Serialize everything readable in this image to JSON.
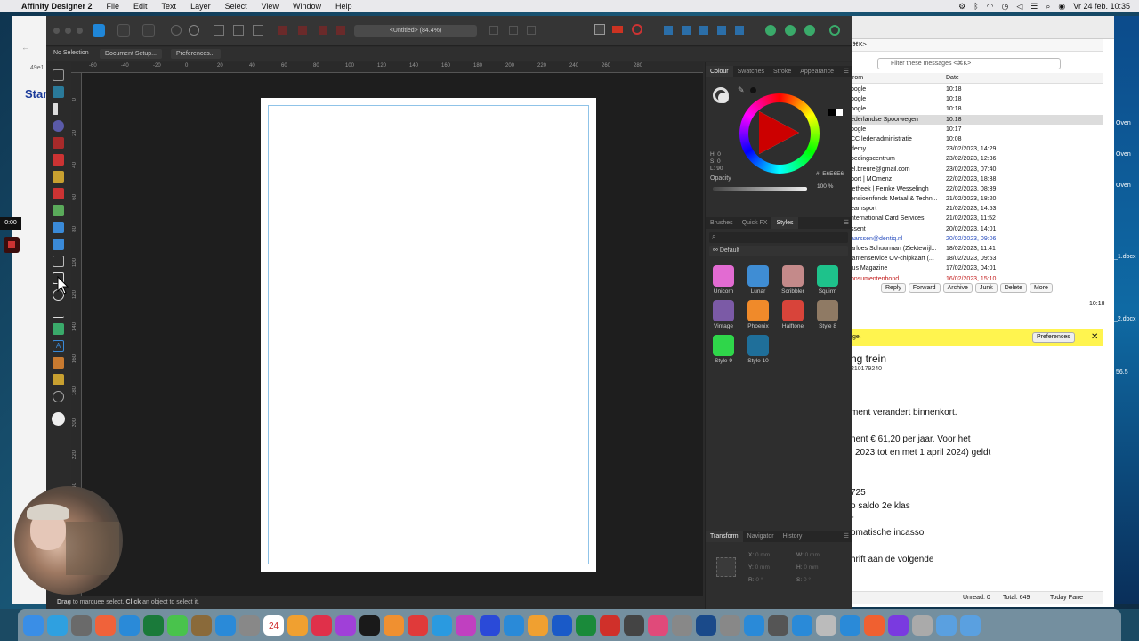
{
  "menubar": {
    "apple": "",
    "app_name": "Affinity Designer 2",
    "items": [
      "File",
      "Edit",
      "Text",
      "Layer",
      "Select",
      "View",
      "Window",
      "Help"
    ],
    "clock": "Vr 24 feb.  10:35"
  },
  "affinity": {
    "document_title": "<Untitled> (84.4%)",
    "context": {
      "selection": "No Selection",
      "document_setup": "Document Setup...",
      "preferences": "Preferences..."
    },
    "ruler_h": [
      "-60",
      "-40",
      "-20",
      "0",
      "20",
      "40",
      "60",
      "80",
      "100",
      "120",
      "140",
      "160",
      "180",
      "200",
      "220",
      "240",
      "260",
      "280"
    ],
    "ruler_v": [
      "0",
      "20",
      "40",
      "60",
      "80",
      "100",
      "120",
      "140",
      "160",
      "180",
      "200",
      "220",
      "240",
      "260",
      "280"
    ],
    "status_bold1": "Drag",
    "status_text1": " to marquee select. ",
    "status_bold2": "Click",
    "status_text2": " an object to select it.",
    "colour_panel": {
      "tabs": [
        "Colour",
        "Swatches",
        "Stroke",
        "Appearance"
      ],
      "hsl": [
        "H: 0",
        "S: 0",
        "L: 90"
      ],
      "hex": "#: E6E6E6",
      "opacity_label": "Opacity",
      "opacity_value": "100 %"
    },
    "styles_panel": {
      "tabs": [
        "Brushes",
        "Quick FX",
        "Styles"
      ],
      "category": "Default",
      "styles": [
        {
          "name": "Unicorn",
          "color": "#e26bd2"
        },
        {
          "name": "Lunar",
          "color": "#3f8dd4"
        },
        {
          "name": "Scribbler",
          "color": "#c48a8a"
        },
        {
          "name": "Squirm",
          "color": "#1ec28b"
        },
        {
          "name": "Vintage",
          "color": "#7b5aa6"
        },
        {
          "name": "Phoenix",
          "color": "#f08a2a"
        },
        {
          "name": "Halftone",
          "color": "#d8443a"
        },
        {
          "name": "Style 8",
          "color": "#8f7a64"
        },
        {
          "name": "Style 9",
          "color": "#2fd64a"
        },
        {
          "name": "Style 10",
          "color": "#1f6f9a"
        }
      ]
    },
    "transform_panel": {
      "tabs": [
        "Transform",
        "Navigator",
        "History"
      ],
      "fields": [
        {
          "label": "X:",
          "value": "0 mm"
        },
        {
          "label": "W:",
          "value": "0 mm"
        },
        {
          "label": "Y:",
          "value": "0 mm"
        },
        {
          "label": "H:",
          "value": "0 mm"
        },
        {
          "label": "R:",
          "value": "0 °"
        },
        {
          "label": "S:",
          "value": "0 °"
        }
      ]
    }
  },
  "mail": {
    "search_placeholder": "Filter these messages <⌘K>",
    "top_field": "⌘K>",
    "col_from": "rom",
    "col_date": "Date",
    "rows": [
      {
        "from": "oogle",
        "date": "10:18",
        "style": ""
      },
      {
        "from": "oogle",
        "date": "10:18",
        "style": ""
      },
      {
        "from": "oogle",
        "date": "10:18",
        "style": ""
      },
      {
        "from": "ederlandse Spoorwegen",
        "date": "10:18",
        "style": "sel"
      },
      {
        "from": "oogle",
        "date": "10:17",
        "style": ""
      },
      {
        "from": "CC ledenadministratie",
        "date": "10:08",
        "style": ""
      },
      {
        "from": "demy",
        "date": "23/02/2023, 14:29",
        "style": ""
      },
      {
        "from": "oedingscentrum",
        "date": "23/02/2023, 12:36",
        "style": ""
      },
      {
        "from": "el.breure@gmail.com",
        "date": "23/02/2023, 07:40",
        "style": ""
      },
      {
        "from": "port | MOmenz",
        "date": "22/02/2023, 18:38",
        "style": ""
      },
      {
        "from": "ietheek | Femke Wesselingh",
        "date": "22/02/2023, 08:39",
        "style": ""
      },
      {
        "from": "ensioenfonds Metaal & Techn...",
        "date": "21/02/2023, 18:20",
        "style": ""
      },
      {
        "from": "eamsport",
        "date": "21/02/2023, 14:53",
        "style": ""
      },
      {
        "from": "nternational Card Services",
        "date": "21/02/2023, 11:52",
        "style": ""
      },
      {
        "from": "ssent",
        "date": "20/02/2023, 14:01",
        "style": ""
      },
      {
        "from": "aarssen@dentiq.nl",
        "date": "20/02/2023, 09:06",
        "style": "blue"
      },
      {
        "from": "arloes Schuurman (Ziektevrijl...",
        "date": "18/02/2023, 11:41",
        "style": ""
      },
      {
        "from": "lantenservice OV-chipkaart (...",
        "date": "18/02/2023, 09:53",
        "style": ""
      },
      {
        "from": "lus Magazine",
        "date": "17/02/2023, 04:01",
        "style": ""
      },
      {
        "from": "onsumentenbond",
        "date": "16/02/2023, 15:10",
        "style": "red"
      }
    ],
    "actions": [
      "Reply",
      "Forward",
      "Archive",
      "Junk",
      "Delete",
      "More"
    ],
    "time": "10:18",
    "notice": "ge.",
    "preferences": "Preferences",
    "subject": "ng trein",
    "subject_id": "210179240",
    "body_lines": [
      "ment verandert binnenkort.",
      "",
      "nent € 61,20 per jaar. Voor het",
      "l 2023 tot en met 1 april 2024) geldt",
      "",
      "",
      "725",
      "o saldo 2e klas",
      "r",
      "omatische incasso",
      "",
      "hrift aan de volgende"
    ],
    "unread": "Unread: 0",
    "total": "Total: 649",
    "today_pane": "Today Pane"
  },
  "right_desktop": [
    "Oven",
    "Oven",
    "Oven",
    "_1.docx",
    "_2.docx",
    "56.5"
  ],
  "left_browser": {
    "tab": "49e1",
    "logo": "Star"
  },
  "recorder": {
    "timer": "0:00"
  },
  "dock_colors": [
    "#3a8ee6",
    "#2fa0e0",
    "#6a6a6a",
    "#f0623a",
    "#2a8ad8",
    "#1a7a3a",
    "#49c34c",
    "#8a6a3a",
    "#2a8ad8",
    "#888",
    "#7a4ad8",
    "#f0a030",
    "#e0304a",
    "#a040d8",
    "#1a1a1a",
    "#f09030",
    "#e03a3a",
    "#2a9ae0",
    "#c040c0",
    "#2a4ad8",
    "#2a8ad8",
    "#f0a030",
    "#1a5ac8",
    "#1a8a3a",
    "#d0302a",
    "#444",
    "#e04a7a",
    "#888",
    "#1a4a8a",
    "#888",
    "#2a8ad8",
    "#555",
    "#2a8ad8",
    "#bbb",
    "#2a8ad8",
    "#f06030",
    "#7a3ae0",
    "#aaa",
    "#5aa0e0",
    "#5aa0e0"
  ],
  "calendar_day": "24"
}
